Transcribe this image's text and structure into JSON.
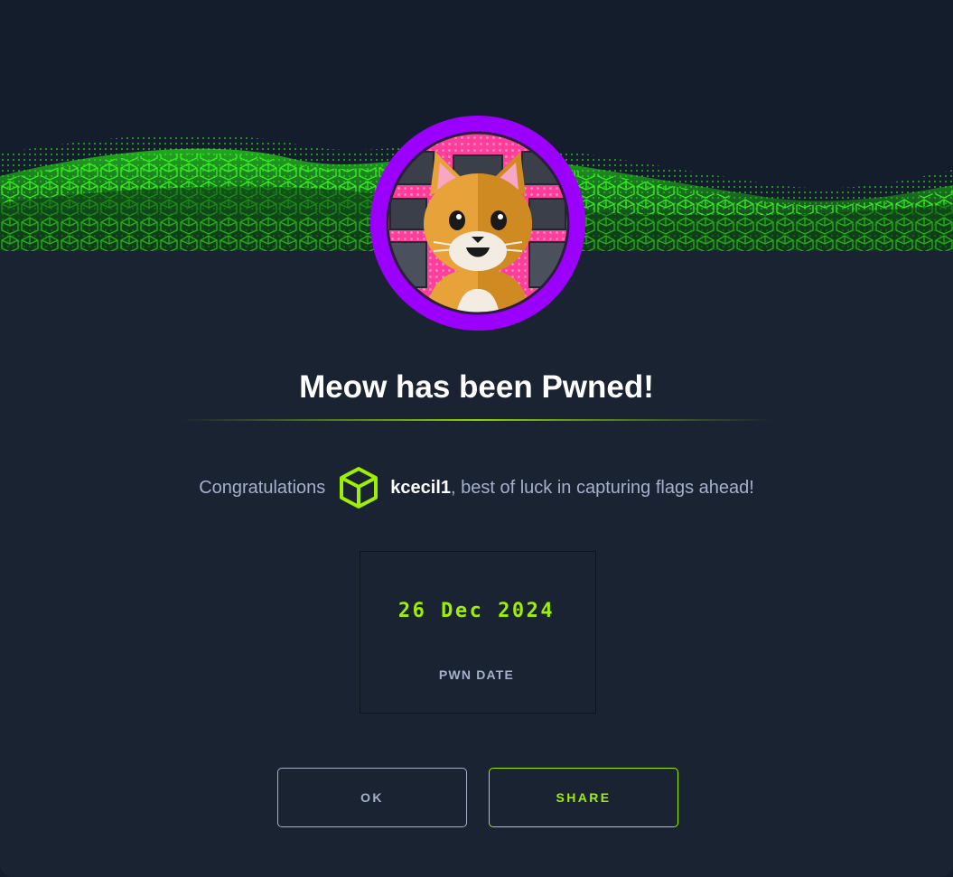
{
  "machine": {
    "name": "Meow",
    "title": "Meow has been Pwned!"
  },
  "message": {
    "prefix": "Congratulations",
    "username": "kcecil1",
    "suffix": ", best of luck in capturing flags ahead!"
  },
  "pwn": {
    "date": "26 Dec 2024",
    "label": "PWN DATE"
  },
  "buttons": {
    "ok": "OK",
    "share": "SHARE"
  },
  "icons": {
    "user_rank": "hexagon-cube-icon",
    "avatar": "cat-avatar-icon"
  },
  "colors": {
    "accent_green": "#9fef00",
    "avatar_ring": "#9b00ff",
    "modal_bg": "#1a2332",
    "text_muted": "#a4b1cd"
  }
}
